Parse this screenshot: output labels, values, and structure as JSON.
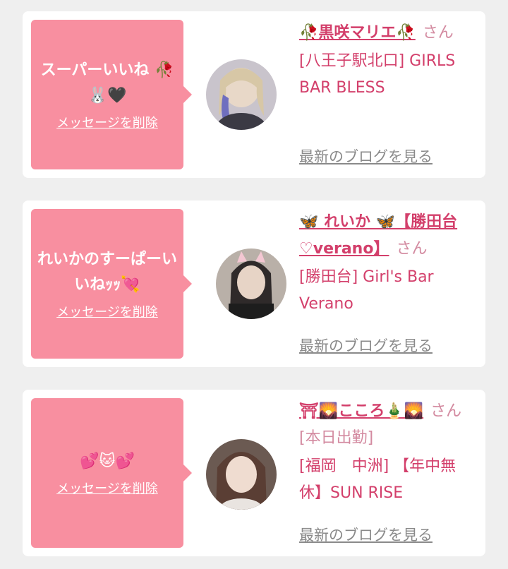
{
  "cards": [
    {
      "message": "スーパーいいね 🥀🐰🖤",
      "delete_label": "メッセージを削除",
      "name": "🥀黒咲マリエ🥀",
      "san": "さん",
      "shop": "[八王子駅北口] GIRLS BAR BLESS",
      "blog_label": "最新のブログを見る"
    },
    {
      "message": "れいかのすーぱーいいねｯｯ💘",
      "delete_label": "メッセージを削除",
      "name": "🦋 れいか 🦋【勝田台♡verano】",
      "san": "さん",
      "shop": "[勝田台] Girl's Bar Verano",
      "blog_label": "最新のブログを見る"
    },
    {
      "message": "💕🐱💕",
      "delete_label": "メッセージを削除",
      "name": "⛩🌄こころ🎍🌄",
      "san": "さん[本日出勤]",
      "shop": "[福岡　中洲] 【年中無休】SUN RISE",
      "blog_label": "最新のブログを見る"
    }
  ],
  "colors": {
    "bubble": "#f88fa0",
    "accent_text": "#d33f6b",
    "link_gray": "#8a8a8a",
    "background": "#efefef"
  }
}
